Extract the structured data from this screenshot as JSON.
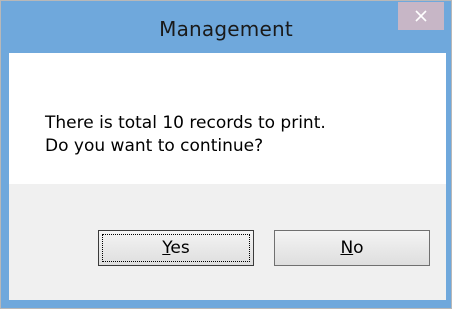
{
  "window": {
    "title": "Management"
  },
  "message": {
    "line1": "There is total 10 records to print.",
    "line2": "Do you want to continue?"
  },
  "buttons": {
    "yes": {
      "mnemonic": "Y",
      "rest": "es"
    },
    "no": {
      "mnemonic": "N",
      "rest": "o"
    }
  },
  "icons": {
    "close": "close-icon"
  },
  "colors": {
    "titlebar": "#6fa8dc",
    "close_button": "#c7b6c6",
    "content_bg": "#ffffff",
    "button_area_bg": "#f0f0f0"
  }
}
